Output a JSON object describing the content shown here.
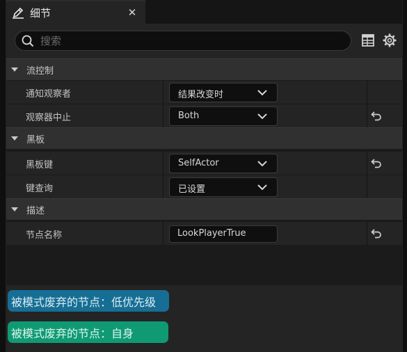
{
  "tab": {
    "title": "细节",
    "icon": "pencil-icon",
    "close_glyph": "✕"
  },
  "search": {
    "placeholder": "搜索",
    "value": ""
  },
  "categories": [
    {
      "label": "流控制"
    },
    {
      "label": "黑板"
    },
    {
      "label": "描述"
    }
  ],
  "properties": [
    {
      "name": "通知观察者",
      "value": "结果改变时",
      "kind": "dropdown",
      "reset": false
    },
    {
      "name": "观察器中止",
      "value": "Both",
      "kind": "dropdown",
      "reset": true
    },
    {
      "name": "黑板键",
      "value": "SelfActor",
      "kind": "dropdown",
      "reset": true
    },
    {
      "name": "键查询",
      "value": "已设置",
      "kind": "dropdown",
      "reset": false
    },
    {
      "name": "节点名称",
      "value": "LookPlayerTrue",
      "kind": "text",
      "reset": true
    }
  ],
  "badges": [
    {
      "label": "被模式废弃的节点：低优先级",
      "color": "#176e94"
    },
    {
      "label": "被模式废弃的节点：自身",
      "color": "#0f9a74"
    }
  ],
  "colors": {
    "background": "#1b1b1b",
    "row": "#242424",
    "category": "#303030"
  }
}
